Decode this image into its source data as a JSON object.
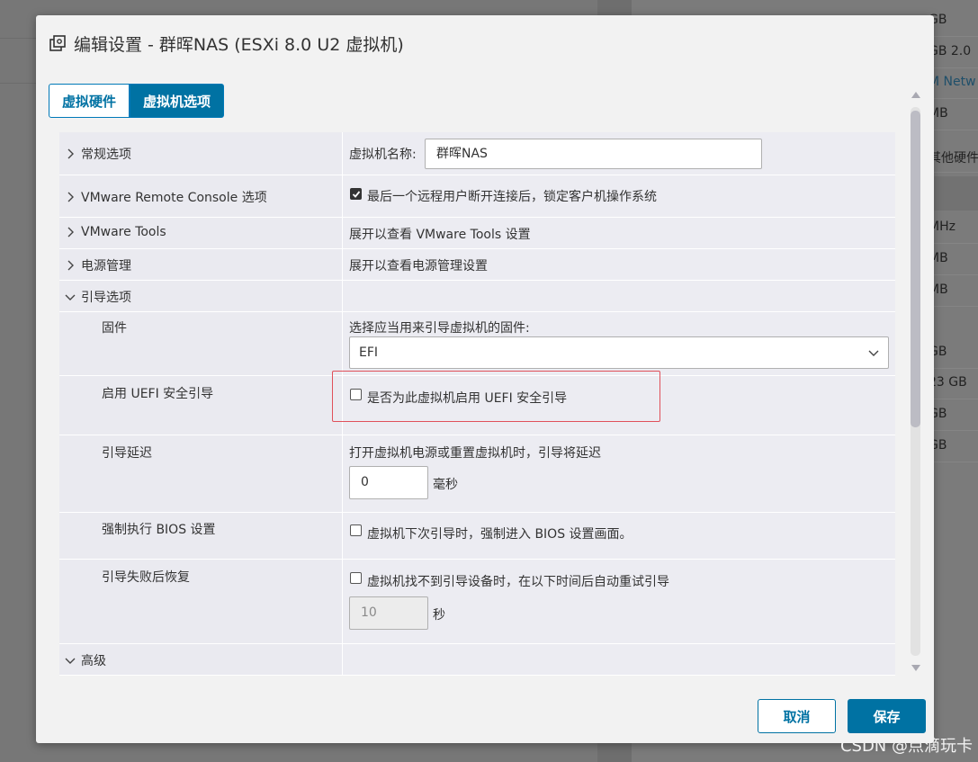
{
  "background_panel": {
    "rows": [
      {
        "text": "GB"
      },
      {
        "text": "GB 2.0"
      },
      {
        "text": "M Netw"
      },
      {
        "text": "MB"
      },
      {
        "text": "其他硬件"
      },
      {
        "text": "MHz"
      },
      {
        "text": "MB"
      },
      {
        "text": "MB"
      },
      {
        "text": "GB"
      },
      {
        "text": "23 GB"
      },
      {
        "text": "GB"
      },
      {
        "text": "GB"
      }
    ]
  },
  "dialog": {
    "title": "编辑设置 - 群晖NAS (ESXi 8.0 U2 虚拟机)"
  },
  "tabs": [
    {
      "label": "虚拟硬件",
      "active": false
    },
    {
      "label": "虚拟机选项",
      "active": true
    }
  ],
  "sections": {
    "general": {
      "label": "常规选项",
      "vm_name_label": "虚拟机名称:",
      "vm_name_value": "群晖NAS"
    },
    "vmrc": {
      "label": "VMware Remote Console 选项",
      "checkbox_label": "最后一个远程用户断开连接后，锁定客户机操作系统",
      "checked": true
    },
    "vmtools": {
      "label": "VMware Tools",
      "info": "展开以查看 VMware Tools 设置"
    },
    "power": {
      "label": "电源管理",
      "info": "展开以查看电源管理设置"
    },
    "boot": {
      "label": "引导选项",
      "firmware": {
        "label": "固件",
        "prompt": "选择应当用来引导虚拟机的固件:",
        "selected": "EFI"
      },
      "uefi_secure": {
        "label": "启用 UEFI 安全引导",
        "checkbox_label": "是否为此虚拟机启用 UEFI 安全引导",
        "checked": false
      },
      "boot_delay": {
        "label": "引导延迟",
        "prompt": "打开虚拟机电源或重置虚拟机时，引导将延迟",
        "value": "0",
        "unit": "毫秒"
      },
      "force_bios": {
        "label": "强制执行 BIOS 设置",
        "checkbox_label": "虚拟机下次引导时，强制进入 BIOS 设置画面。",
        "checked": false
      },
      "failed_recovery": {
        "label": "引导失败后恢复",
        "checkbox_label": "虚拟机找不到引导设备时，在以下时间后自动重试引导",
        "checked": false,
        "value": "10",
        "unit": "秒"
      }
    },
    "advanced": {
      "label": "高级"
    }
  },
  "buttons": {
    "cancel": "取消",
    "save": "保存"
  },
  "watermark": "CSDN @点滴玩卡",
  "colors": {
    "accent": "#0072a3",
    "highlight": "#e0505a"
  }
}
